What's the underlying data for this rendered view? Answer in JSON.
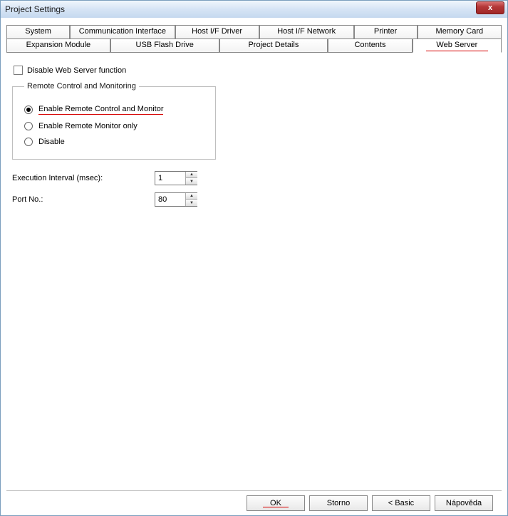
{
  "window": {
    "title": "Project Settings",
    "close_glyph": "x"
  },
  "tabs": {
    "row1": {
      "system": "System",
      "comm": "Communication Interface",
      "hif_drv": "Host I/F Driver",
      "hif_net": "Host I/F Network",
      "printer": "Printer",
      "memcard": "Memory Card"
    },
    "row2": {
      "expmod": "Expansion Module",
      "usb": "USB Flash Drive",
      "proj": "Project Details",
      "cont": "Contents",
      "web": "Web Server"
    }
  },
  "panel": {
    "disable_label": "Disable Web Server function",
    "group_legend": "Remote Control and Monitoring",
    "radios": {
      "r1": "Enable Remote Control and Monitor",
      "r2": "Enable Remote Monitor only",
      "r3": "Disable"
    },
    "exec_label": "Execution Interval (msec):",
    "exec_value": "1",
    "port_label": "Port No.:",
    "port_value": "80"
  },
  "footer": {
    "ok": "OK",
    "storno": "Storno",
    "basic": "< Basic",
    "help": "Nápověda"
  },
  "glyphs": {
    "up": "▲",
    "down": "▼"
  }
}
